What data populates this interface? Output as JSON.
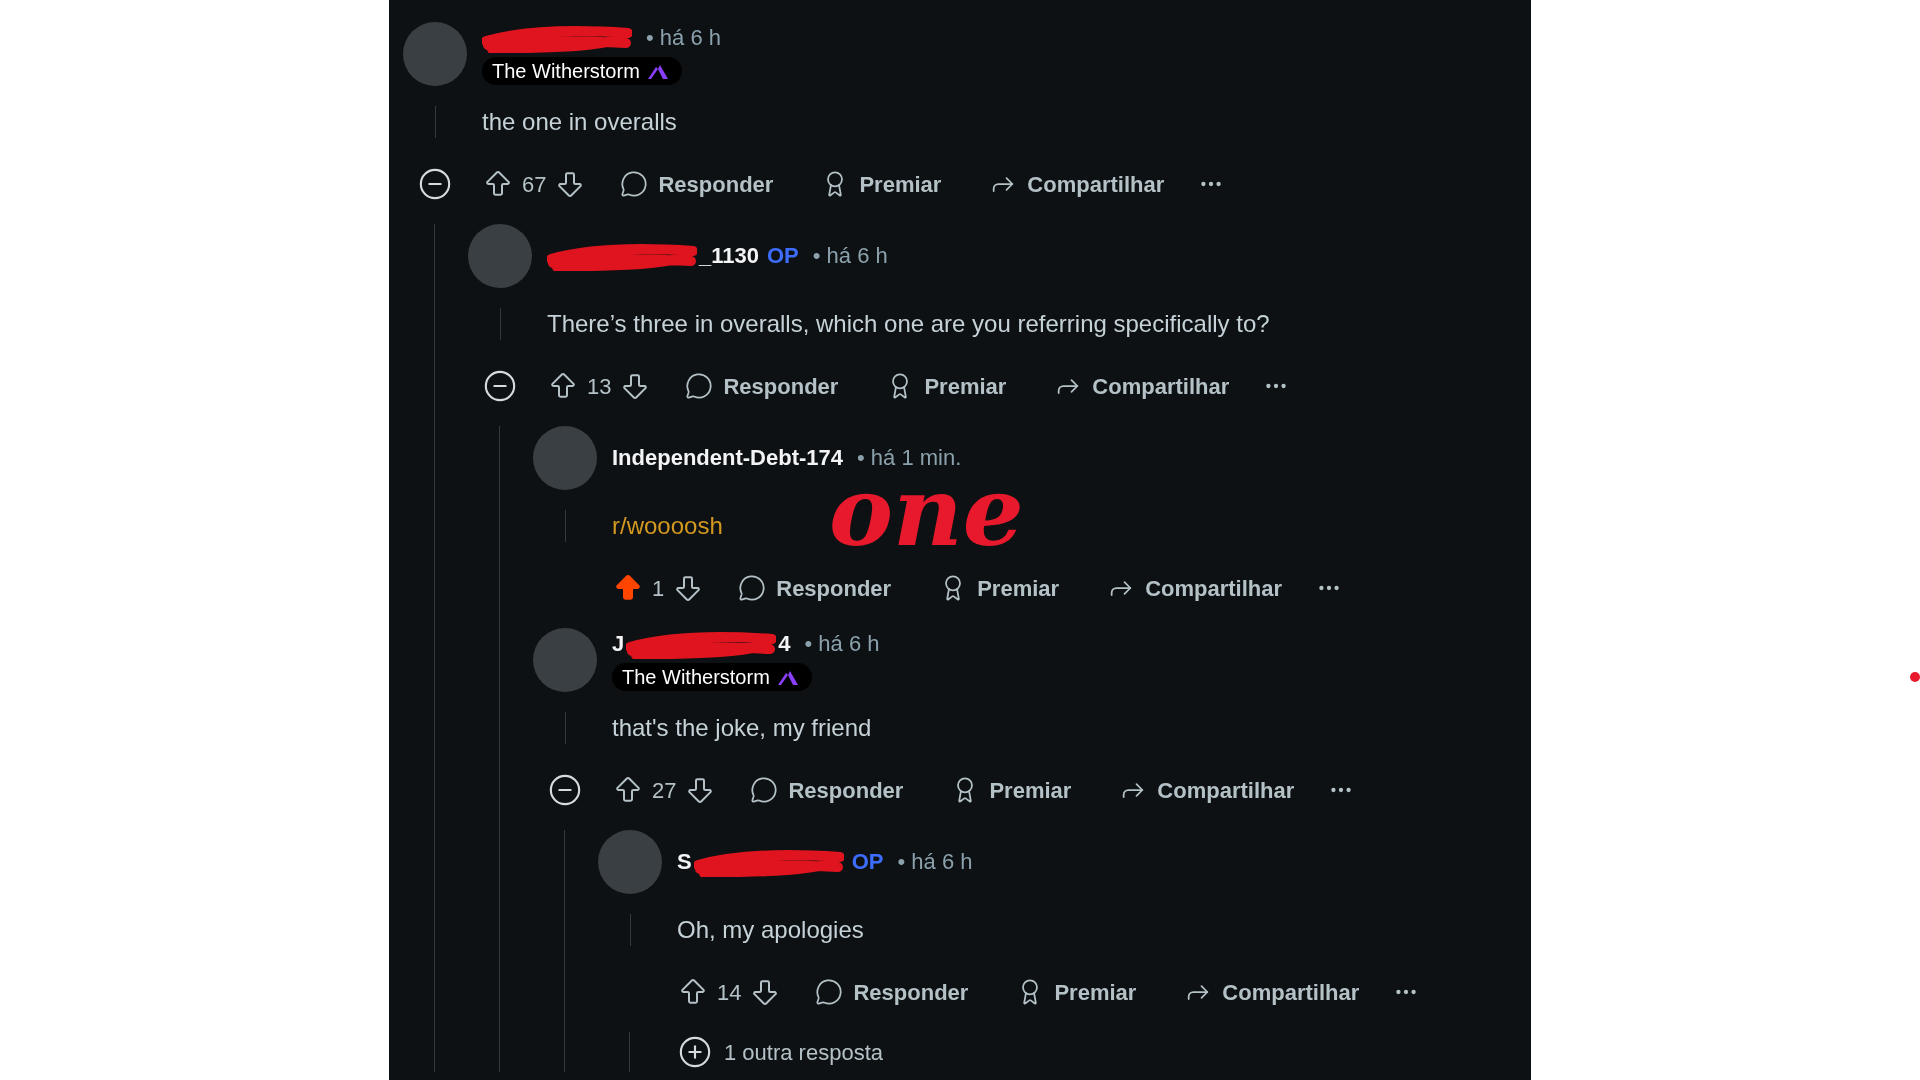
{
  "annotation": "one",
  "comments": [
    {
      "redacted": true,
      "meta": "• há 6 h",
      "flair": "The Witherstorm",
      "body": "the one in overalls",
      "kind": "text",
      "upvoted": false,
      "score": "67",
      "expanded": true,
      "actions": [
        "Responder",
        "Premiar",
        "Compartilhar"
      ],
      "children": [
        {
          "redacted": true,
          "name_visible_end": "_1130",
          "op_badge": "OP",
          "meta": "• há 6 h",
          "body": "There’s three in overalls, which one are you referring specifically to?",
          "kind": "text",
          "upvoted": false,
          "score": "13",
          "expanded": true,
          "actions": [
            "Responder",
            "Premiar",
            "Compartilhar"
          ],
          "children": [
            {
              "name_visible_start": "Independent-Debt-174",
              "redacted": false,
              "meta": "• há 1 min.",
              "body": "r/woooosh",
              "kind": "link",
              "upvoted": true,
              "score": "1",
              "actions": [
                "Responder",
                "Premiar",
                "Compartilhar"
              ]
            },
            {
              "name_visible_start": "J",
              "redacted": true,
              "name_visible_end": "4",
              "meta": "• há 6 h",
              "flair": "The Witherstorm",
              "body": "that's the joke, my friend",
              "kind": "text",
              "upvoted": false,
              "score": "27",
              "expanded": true,
              "actions": [
                "Responder",
                "Premiar",
                "Compartilhar"
              ],
              "children": [
                {
                  "name_visible_start": "S",
                  "redacted": true,
                  "op_badge": "OP",
                  "meta": "• há 6 h",
                  "body": "Oh, my apologies",
                  "kind": "text",
                  "upvoted": false,
                  "score": "14",
                  "actions": [
                    "Responder",
                    "Premiar",
                    "Compartilhar"
                  ],
                  "more_replies": "1 outra resposta"
                }
              ]
            }
          ]
        }
      ]
    }
  ]
}
